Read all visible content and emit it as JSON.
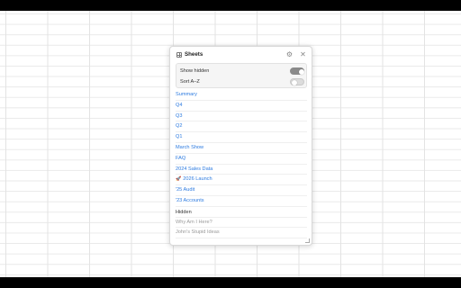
{
  "panel": {
    "title": "Sheets",
    "icons": {
      "header": "sheets-icon",
      "settings": "gear-icon",
      "close": "close-icon"
    }
  },
  "options": {
    "show_hidden": {
      "label": "Show hidden",
      "on": true
    },
    "sort_az": {
      "label": "Sort A–Z",
      "on": false
    }
  },
  "sheets": [
    {
      "label": "Summary"
    },
    {
      "label": "Q4"
    },
    {
      "label": "Q3"
    },
    {
      "label": "Q2"
    },
    {
      "label": "Q1"
    },
    {
      "label": "March Show"
    },
    {
      "label": "FAQ"
    },
    {
      "label": "2024 Sales Data"
    },
    {
      "label": "2026 Launch",
      "icon": "rocket-icon"
    },
    {
      "label": "'25 Audit"
    },
    {
      "label": "'23 Accounts"
    }
  ],
  "hidden_section": {
    "title": "Hidden",
    "items": [
      {
        "label": "Why Am I Here?"
      },
      {
        "label": "John's Stupid Ideas"
      }
    ]
  },
  "colors": {
    "link": "#2d7be0",
    "hidden_text": "#9a9a9a"
  }
}
